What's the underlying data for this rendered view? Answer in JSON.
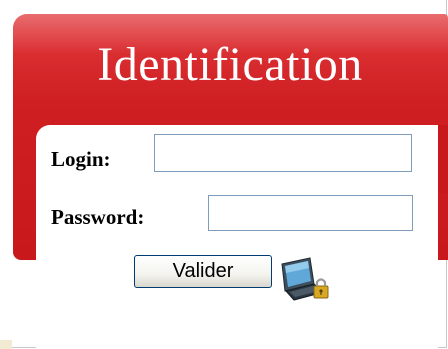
{
  "login_box": {
    "title": "Identification",
    "login_label": "Login:",
    "login_value": "",
    "password_label": "Password:",
    "password_value": "",
    "submit_label": "Valider",
    "icon": "computer-lock-icon"
  },
  "colors": {
    "panel_red": "#c8181c",
    "title_text": "#ffffff",
    "input_border": "#7f9db9"
  }
}
